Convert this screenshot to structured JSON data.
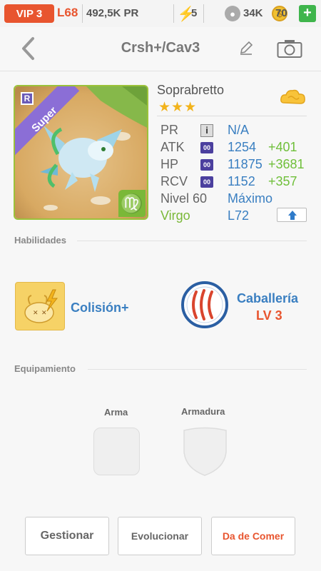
{
  "status_bar": {
    "vip": "VIP 3",
    "level": "L68",
    "power": "492,5K PR",
    "energy": "5",
    "food": "34K",
    "coins": "70",
    "add_label": "+"
  },
  "header": {
    "title": "Crsh+/Cav3"
  },
  "monster": {
    "name": "Soprabretto",
    "rarity_badge": "Super",
    "rank_letter": "R",
    "stars": "★★★",
    "sign_symbol": "♍",
    "stats": {
      "pr_label": "PR",
      "pr_info": "i",
      "pr_value": "N/A",
      "atk_label": "ATK",
      "atk_chip": "00",
      "atk_value": "1254",
      "atk_bonus": "+401",
      "hp_label": "HP",
      "hp_chip": "00",
      "hp_value": "11875",
      "hp_bonus": "+3681",
      "rcv_label": "RCV",
      "rcv_chip": "00",
      "rcv_value": "1152",
      "rcv_bonus": "+357",
      "level_label": "Nivel 60",
      "level_value": "Máximo",
      "sign_label": "Virgo",
      "sign_value": "L72"
    }
  },
  "skills": {
    "section_title": "Habilidades",
    "skill1_name": "Colisión+",
    "skill2_name": "Caballería",
    "skill2_level": "LV 3"
  },
  "equipment": {
    "section_title": "Equipamiento",
    "weapon_label": "Arma",
    "armor_label": "Armadura"
  },
  "actions": {
    "manage": "Gestionar",
    "evolve": "Evolucionar",
    "feed": "Da de Comer"
  },
  "colors": {
    "accent_orange": "#e8552f",
    "blue_value": "#3a7fc1",
    "green_bonus": "#6fbf3a",
    "star_gold": "#f2b31b"
  }
}
